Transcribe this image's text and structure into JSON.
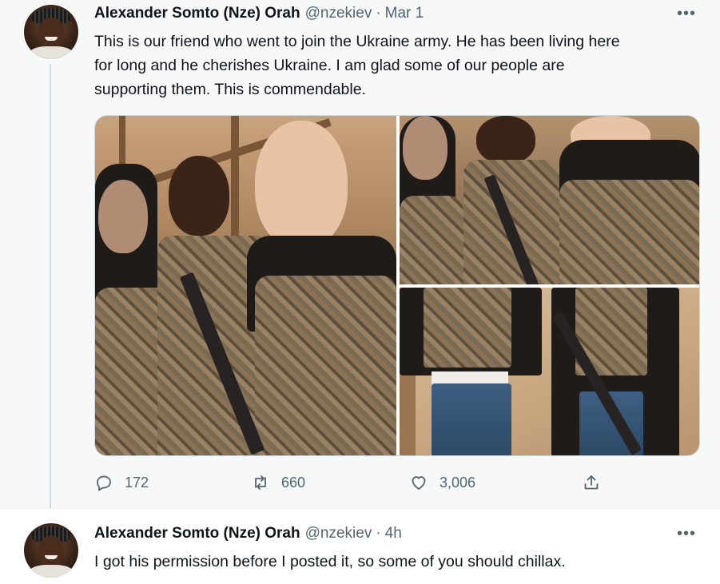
{
  "tweets": [
    {
      "author_name": "Alexander Somto (Nze) Orah",
      "handle": "@nzekiev",
      "separator": "·",
      "time": "Mar 1",
      "more": "•••",
      "text_lines": [
        "This is our friend who went to join the Ukraine army. He has been living here",
        "for long and he cherishes Ukraine. I am glad some of our people are",
        "supporting them. This is commendable."
      ],
      "reply_count": "172",
      "retweet_count": "660",
      "like_count": "3,006",
      "icons": [
        "reply-icon",
        "retweet-icon",
        "like-icon",
        "share-icon"
      ]
    },
    {
      "author_name": "Alexander Somto (Nze) Orah",
      "handle": "@nzekiev",
      "separator": "·",
      "time": "4h",
      "more": "•••",
      "text": "I got his permission before I posted it, so some of you should chillax."
    }
  ],
  "colors": {
    "text_primary": "#0f1419",
    "text_secondary": "#536471",
    "thread_line": "#cfd9de",
    "tweet_bg_highlight": "#f7f9f9"
  }
}
